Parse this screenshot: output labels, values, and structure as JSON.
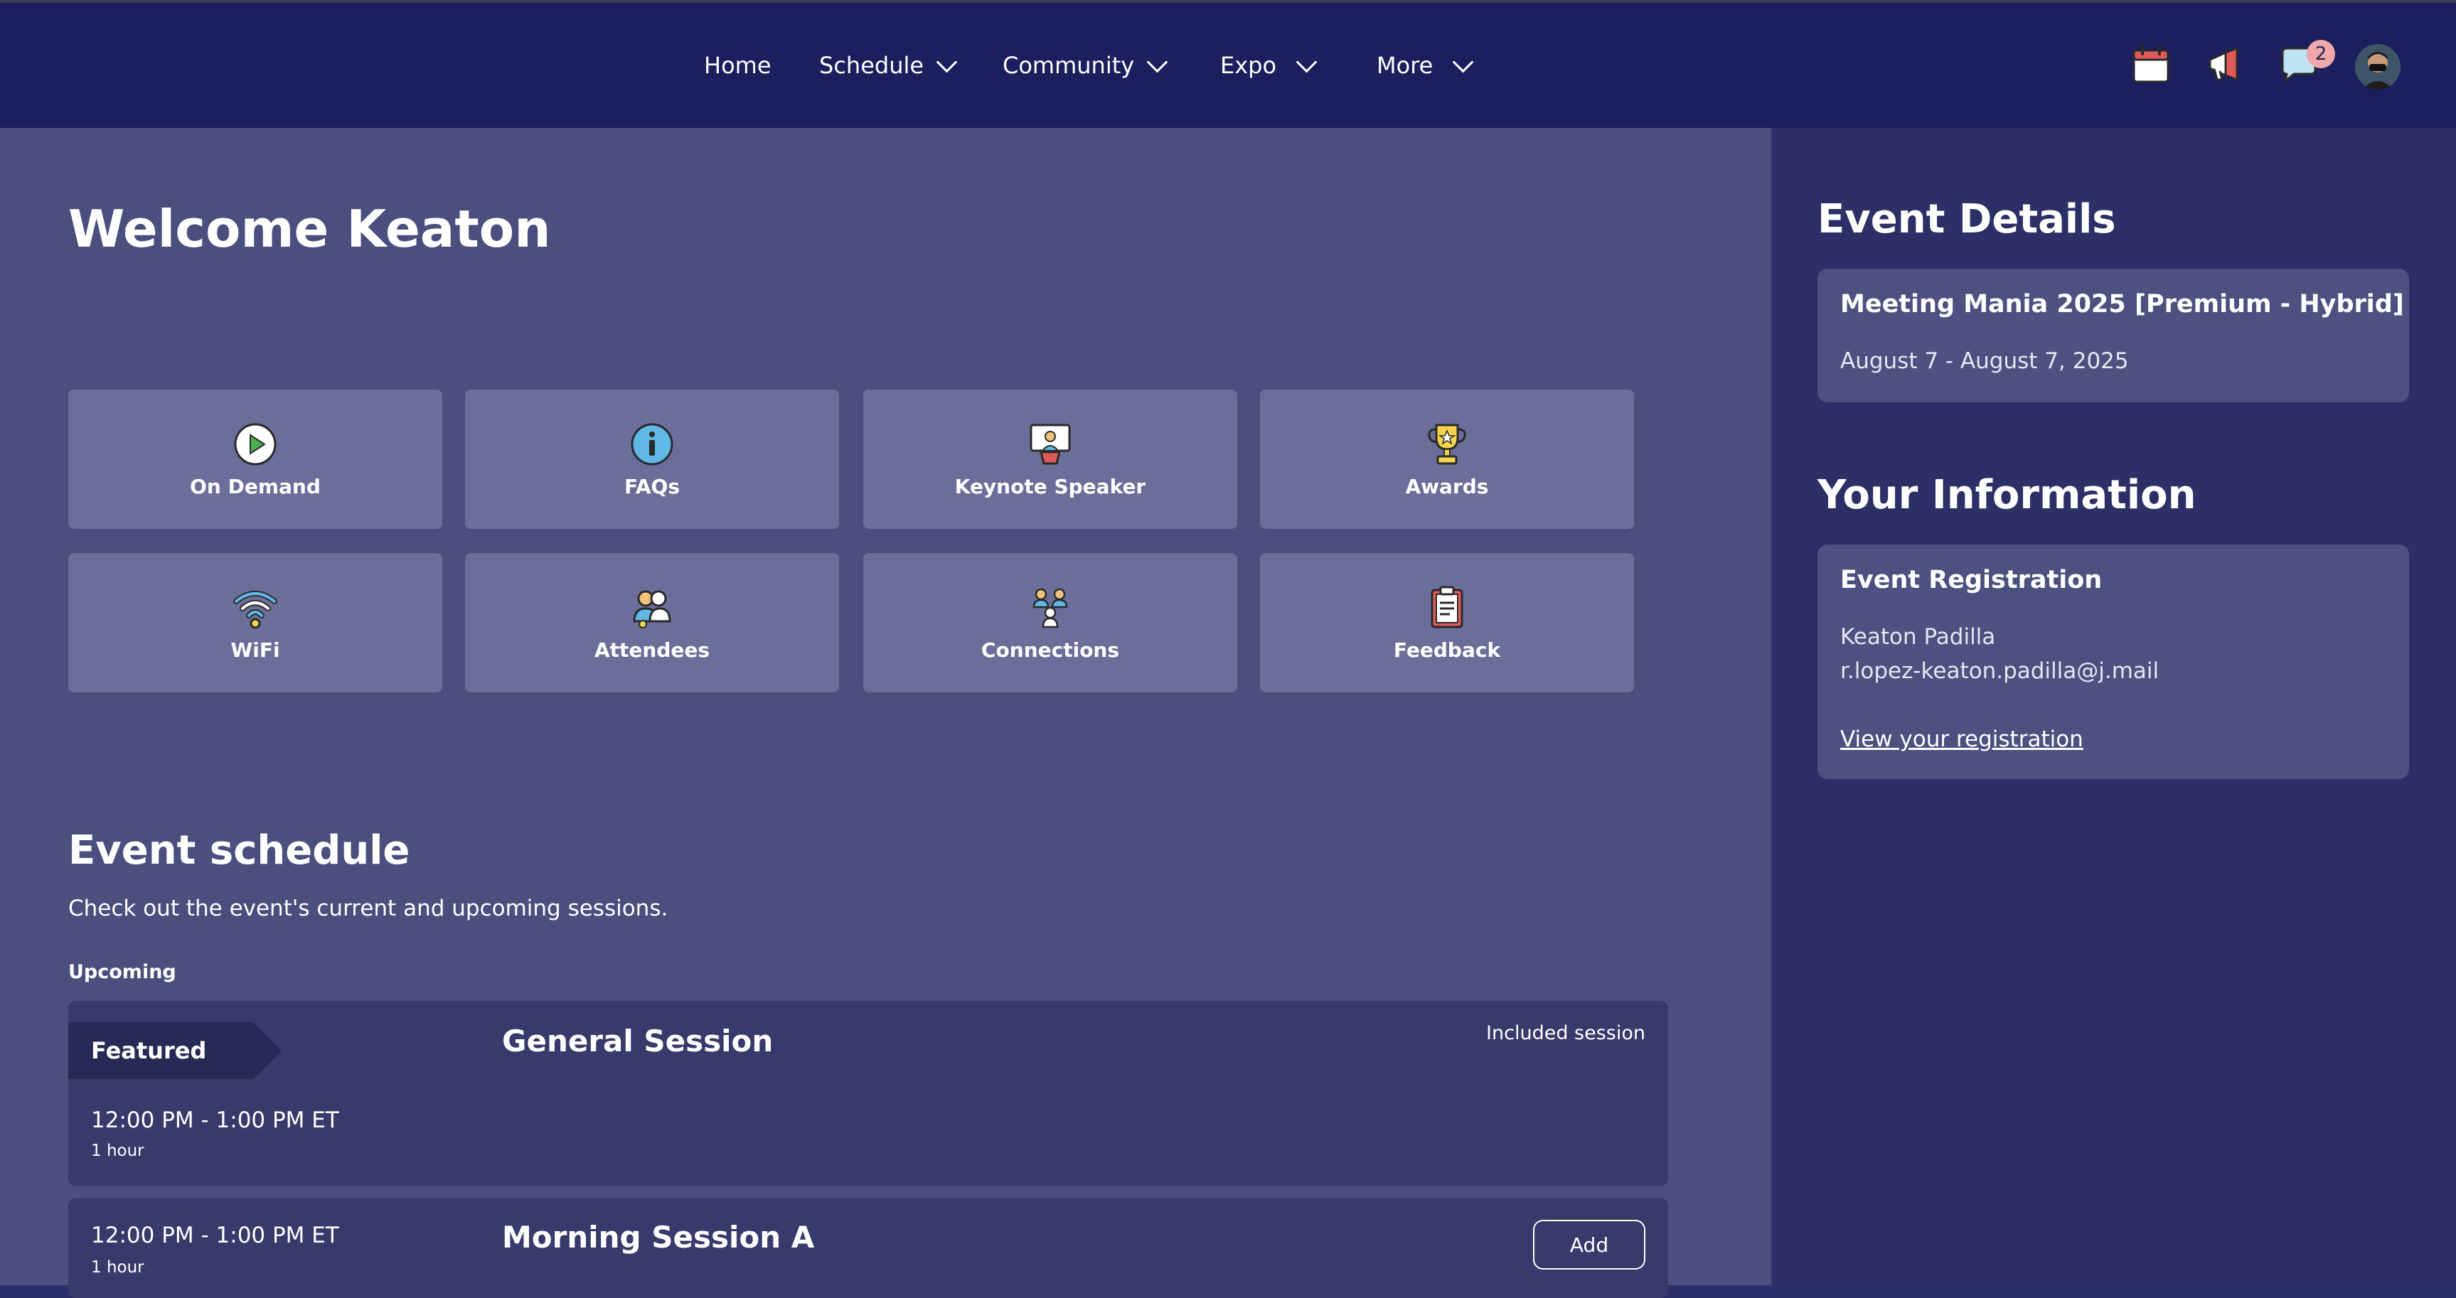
{
  "nav": {
    "items": [
      {
        "label": "Home"
      },
      {
        "label": "Schedule"
      },
      {
        "label": "Community"
      },
      {
        "label": "Expo"
      },
      {
        "label": "More"
      }
    ],
    "message_badge": "2",
    "icons": [
      "calendar-icon",
      "megaphone-icon",
      "chat-icon",
      "avatar"
    ]
  },
  "main": {
    "welcome": "Welcome Keaton",
    "tiles": [
      {
        "label": "On Demand",
        "icon": "play-icon"
      },
      {
        "label": "FAQs",
        "icon": "info-icon"
      },
      {
        "label": "Keynote Speaker",
        "icon": "speaker-icon"
      },
      {
        "label": "Awards",
        "icon": "trophy-icon"
      },
      {
        "label": "WiFi",
        "icon": "wifi-icon"
      },
      {
        "label": "Attendees",
        "icon": "attendees-icon"
      },
      {
        "label": "Connections",
        "icon": "connections-icon"
      },
      {
        "label": "Feedback",
        "icon": "clipboard-icon"
      }
    ],
    "schedule": {
      "title": "Event schedule",
      "subtitle": "Check out the event's current and upcoming sessions.",
      "upcoming": "Upcoming",
      "sessions": [
        {
          "featured": "Featured",
          "time": "12:00 PM - 1:00 PM ET",
          "duration": "1 hour",
          "title": "General Session",
          "status": "Included session"
        },
        {
          "time": "12:00 PM - 1:00 PM ET",
          "duration": "1 hour",
          "title": "Morning Session A",
          "action": "Add"
        }
      ]
    }
  },
  "side": {
    "event_details_title": "Event Details",
    "event_name": "Meeting Mania 2025 [Premium - Hybrid]",
    "event_dates": "August 7 - August 7, 2025",
    "your_info_title": "Your Information",
    "registration_title": "Event Registration",
    "user_name": "Keaton Padilla",
    "user_email": "r.lopez-keaton.padilla@j.mail",
    "registration_link": "View your registration"
  },
  "colors": {
    "topbar": "#1b1f5e",
    "main_bg": "#4a4f7e",
    "side_bg": "#2c3066",
    "tile_bg": "#6b6e98",
    "card_bg": "#373a6b",
    "badge": "#f0a8a8"
  }
}
